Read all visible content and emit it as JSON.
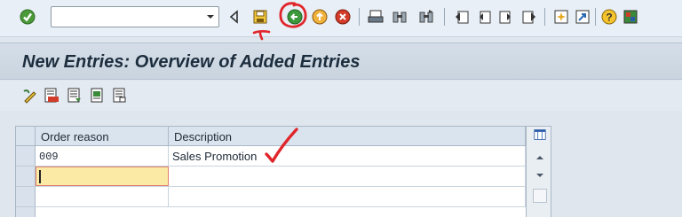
{
  "toolbar": {
    "command_field": {
      "value": "",
      "placeholder": ""
    },
    "icons": [
      "enter-checkmark-icon",
      "back-icon",
      "save-icon",
      "back-green-icon",
      "exit-icon",
      "cancel-icon",
      "print-icon",
      "find-icon",
      "find-next-icon",
      "first-page-icon",
      "previous-page-icon",
      "next-page-icon",
      "last-page-icon",
      "new-session-icon",
      "shortcut-icon",
      "help-icon",
      "layout-menu-icon"
    ]
  },
  "title": "New Entries: Overview of Added Entries",
  "app_toolbar": {
    "icons": [
      "change-display-icon",
      "delete-icon",
      "select-all-icon",
      "select-block-icon",
      "deselect-all-icon"
    ]
  },
  "table": {
    "columns": [
      "Order reason",
      "Description"
    ],
    "rows": [
      {
        "order_reason": "009",
        "description": "Sales Promotion"
      },
      {
        "order_reason": "",
        "description": ""
      },
      {
        "order_reason": "",
        "description": ""
      }
    ]
  },
  "colors": {
    "background": "#dfe6ee",
    "title_bar": "#cfd9e3",
    "edit_cell": "#fbe9a6",
    "annotation_red": "#e0262b",
    "green_icon": "#3c9a3c"
  }
}
